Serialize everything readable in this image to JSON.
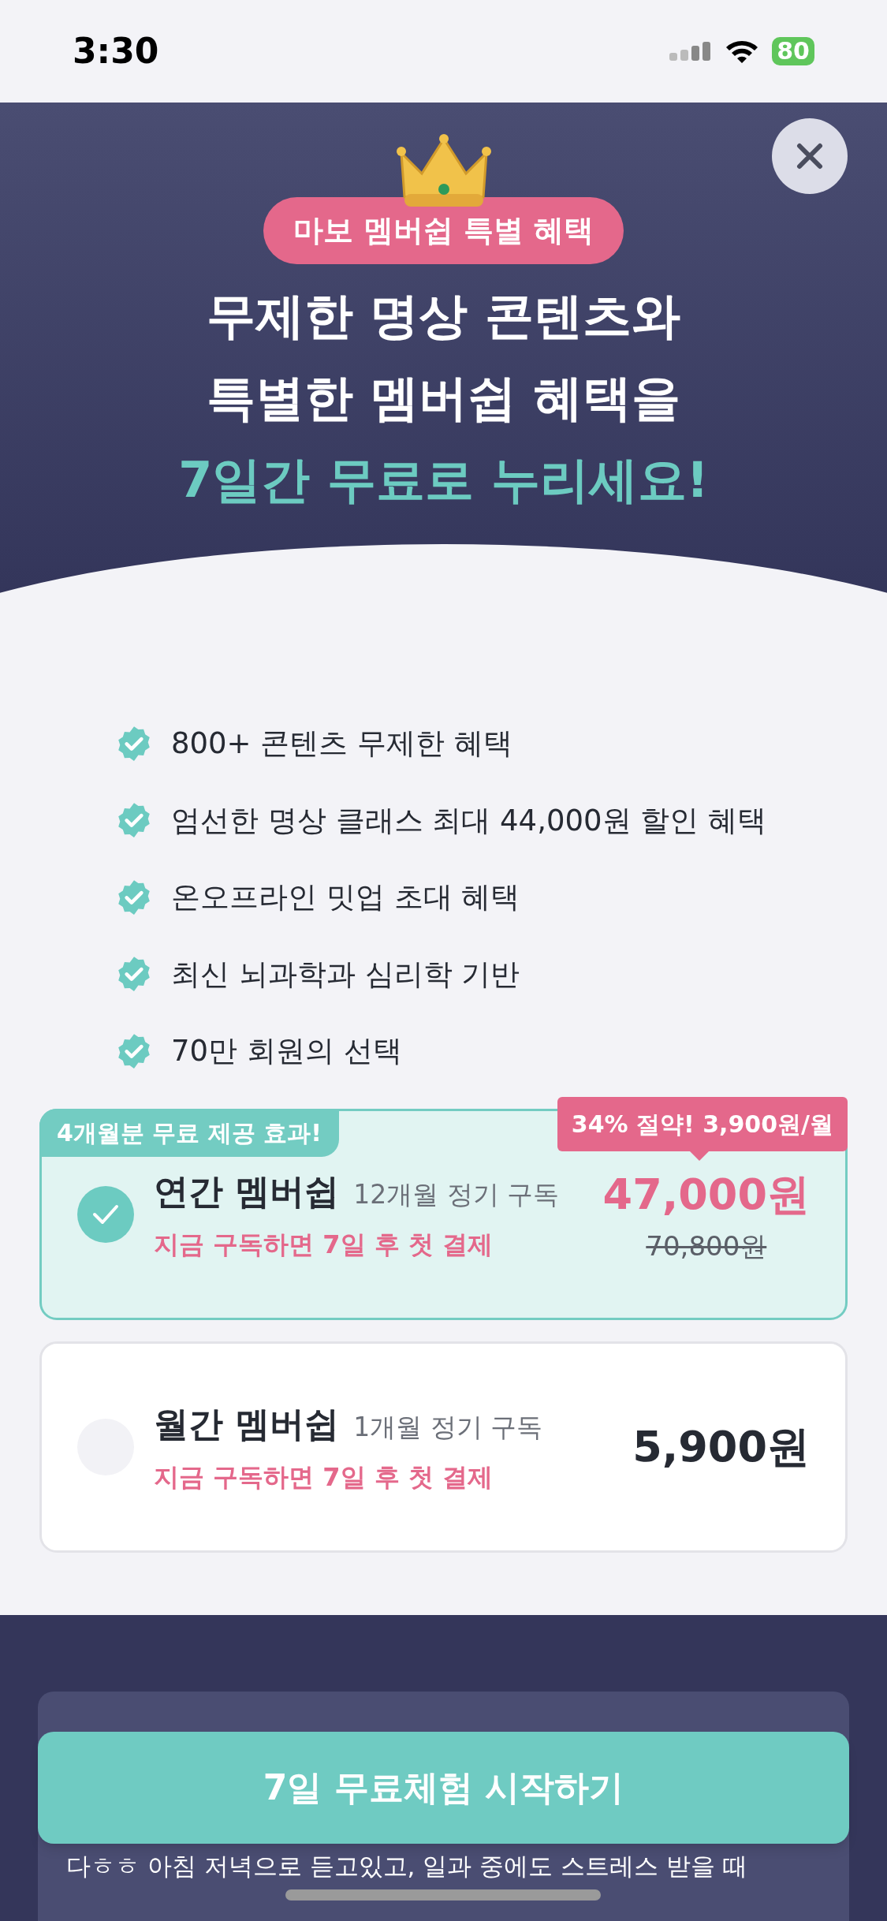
{
  "status_bar": {
    "time": "3:30",
    "battery": "80"
  },
  "header": {
    "badge": "마보 멤버쉽 특별 혜택",
    "title_lines": [
      "무제한 명상 콘텐츠와",
      "특별한 멤버쉽 혜택을"
    ],
    "highlight": "7일간 무료로 누리세요!"
  },
  "benefits": [
    "800+ 콘텐츠 무제한 혜택",
    "엄선한 명상 클래스 최대 44,000원 할인 혜택",
    "온오프라인 밋업 초대 혜택",
    "최신 뇌과학과 심리학 기반",
    "70만 회원의 선택"
  ],
  "plans": [
    {
      "name": "연간 멤버쉽",
      "period": "12개월 정기 구독",
      "note": "지금 구독하면 7일 후 첫 결제",
      "price": "47,000원",
      "original_price": "70,800원",
      "tag": "4개월분 무료 제공 효과!",
      "tooltip": "34% 절약! 3,900원/월",
      "selected": true
    },
    {
      "name": "월간 멤버쉽",
      "period": "1개월 정기 구독",
      "note": "지금 구독하면 7일 후 첫 결제",
      "price": "5,900원",
      "selected": false
    }
  ],
  "review": {
    "text": "다ㅎㅎ 아침 저녁으로 듣고있고, 일과 중에도 스트레스 받을 때"
  },
  "cta": "7일 무료체험 시작하기"
}
